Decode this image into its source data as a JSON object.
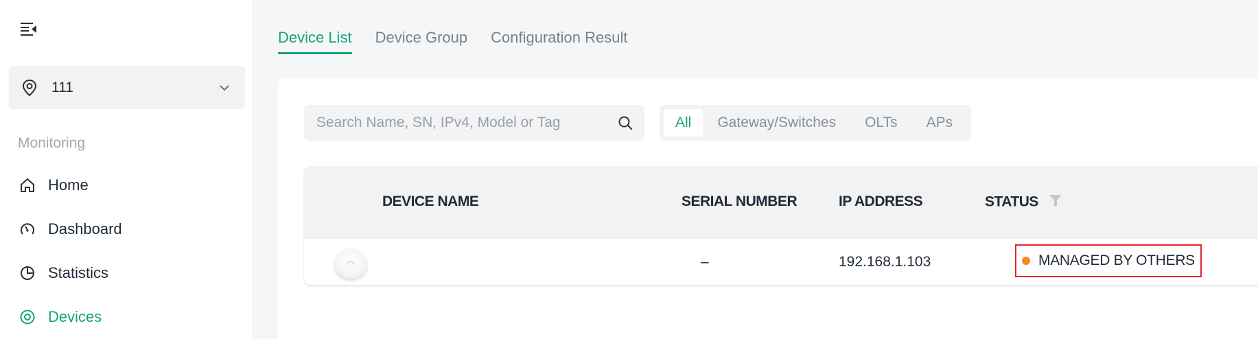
{
  "sidebar": {
    "site": {
      "name": "111"
    },
    "section_label": "Monitoring",
    "items": [
      {
        "label": "Home",
        "icon": "home-icon"
      },
      {
        "label": "Dashboard",
        "icon": "dashboard-icon"
      },
      {
        "label": "Statistics",
        "icon": "statistics-icon"
      },
      {
        "label": "Devices",
        "icon": "devices-icon",
        "active": true
      }
    ]
  },
  "tabs": [
    {
      "label": "Device List",
      "active": true
    },
    {
      "label": "Device Group"
    },
    {
      "label": "Configuration Result"
    }
  ],
  "search": {
    "placeholder": "Search Name, SN, IPv4, Model or Tag",
    "value": ""
  },
  "filters": [
    {
      "label": "All",
      "active": true
    },
    {
      "label": "Gateway/Switches"
    },
    {
      "label": "OLTs"
    },
    {
      "label": "APs"
    }
  ],
  "table": {
    "headers": {
      "device_name": "DEVICE NAME",
      "serial_number": "SERIAL NUMBER",
      "ip_address": "IP ADDRESS",
      "status": "STATUS"
    },
    "rows": [
      {
        "device_name": "",
        "serial_number": "–",
        "ip_address": "192.168.1.103",
        "status": "MANAGED BY OTHERS",
        "status_color": "#f08a24"
      }
    ]
  },
  "colors": {
    "accent": "#16a37a",
    "highlight_border": "#e0262c"
  }
}
